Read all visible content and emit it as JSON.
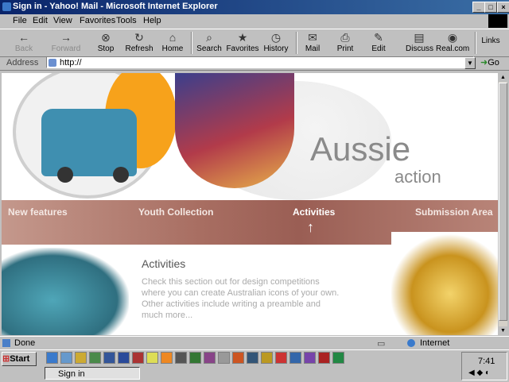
{
  "window": {
    "title": "Sign in - Yahoo! Mail - Microsoft Internet Explorer"
  },
  "menu": [
    "File",
    "Edit",
    "View",
    "Favorites",
    "Tools",
    "Help"
  ],
  "toolbar": {
    "back": "Back",
    "forward": "Forward",
    "stop": "Stop",
    "refresh": "Refresh",
    "home": "Home",
    "search": "Search",
    "favorites": "Favorites",
    "history": "History",
    "mail": "Mail",
    "print": "Print",
    "edit": "Edit",
    "discuss": "Discuss",
    "realcom": "Real.com",
    "links": "Links"
  },
  "address": {
    "label": "Address",
    "value": "http://",
    "go": "Go"
  },
  "page": {
    "banner_word1": "Aussie",
    "banner_word2": "action",
    "nav": [
      "New features",
      "Youth Collection",
      "Activities",
      "Submission Area"
    ],
    "section_title": "Activities",
    "section_text": "Check this section out for design competitions where you can create Australian icons of your own. Other activities include writing a preamble and much more..."
  },
  "status": {
    "text": "Done",
    "zone": "Internet"
  },
  "taskbar": {
    "start": "Start",
    "task": "Sign in",
    "clock": "7:41"
  }
}
